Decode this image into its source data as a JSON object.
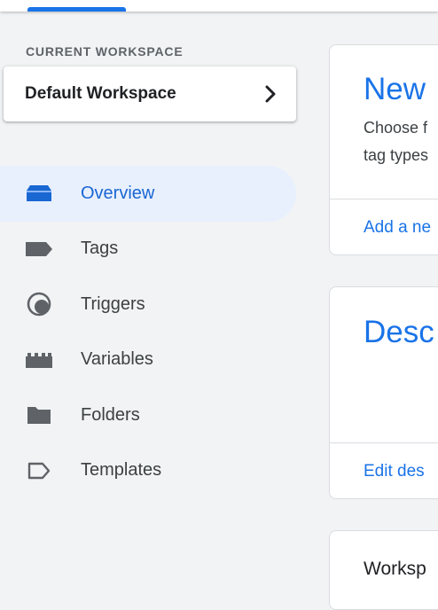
{
  "workspace": {
    "section_label": "CURRENT WORKSPACE",
    "name": "Default Workspace",
    "chevron_icon": "chevron-right-icon"
  },
  "nav": {
    "items": [
      {
        "label": "Overview",
        "icon": "overview-icon",
        "active": true
      },
      {
        "label": "Tags",
        "icon": "tag-icon",
        "active": false
      },
      {
        "label": "Triggers",
        "icon": "trigger-icon",
        "active": false
      },
      {
        "label": "Variables",
        "icon": "variables-icon",
        "active": false
      },
      {
        "label": "Folders",
        "icon": "folder-icon",
        "active": false
      },
      {
        "label": "Templates",
        "icon": "template-icon",
        "active": false
      }
    ]
  },
  "cards": {
    "new_tag": {
      "title": "New",
      "desc_line1": "Choose f",
      "desc_line2": "tag types",
      "link": "Add a ne"
    },
    "description": {
      "title": "Desc",
      "link": "Edit des"
    },
    "workspace_changes": {
      "title": "Worksp"
    }
  },
  "colors": {
    "accent": "#1a73e8",
    "active_bg": "#e8f0fe",
    "active_text": "#1967d2",
    "page_bg": "#f1f3f4",
    "icon": "#5f6368"
  }
}
